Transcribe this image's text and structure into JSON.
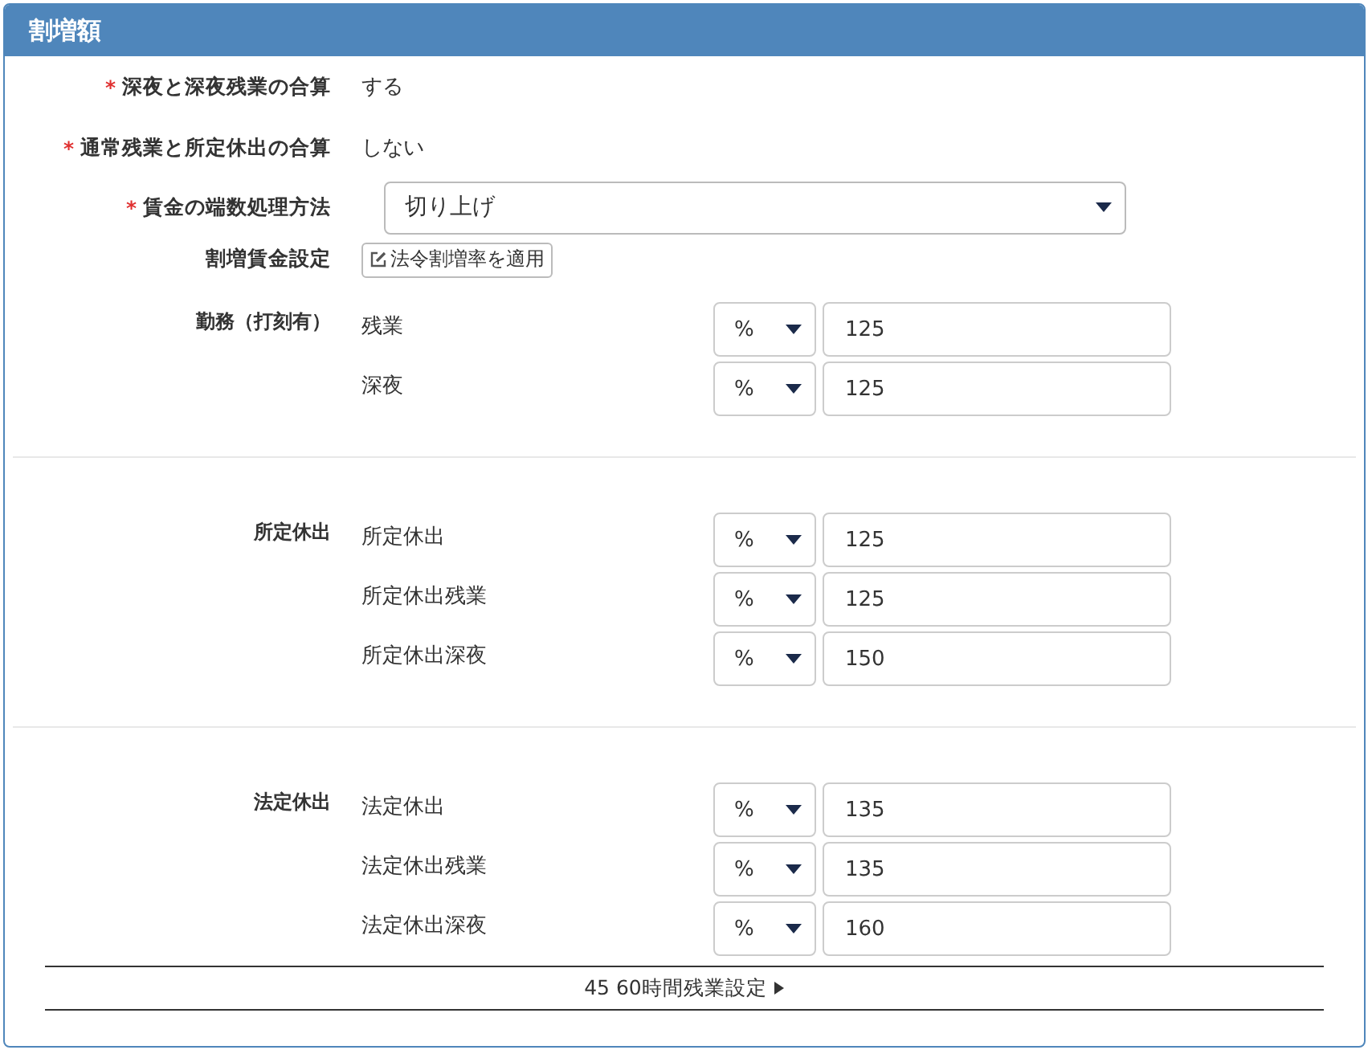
{
  "panel": {
    "title": "割増額"
  },
  "settings": [
    {
      "kind": "text",
      "required_mark": "*",
      "label": "深夜と深夜残業の合算",
      "value": "する"
    },
    {
      "kind": "text",
      "required_mark": "*",
      "label": "通常残業と所定休出の合算",
      "value": "しない"
    },
    {
      "kind": "select",
      "required_mark": "*",
      "label": "賃金の端数処理方法",
      "value": "切り上げ"
    },
    {
      "kind": "button",
      "label": "割増賃金設定",
      "value": "法令割増率を適用"
    }
  ],
  "groups": [
    {
      "label": "勤務（打刻有）",
      "rows": [
        {
          "label": "残業",
          "unit": "%",
          "value": "125"
        },
        {
          "label": "深夜",
          "unit": "%",
          "value": "125"
        }
      ]
    },
    {
      "label": "所定休出",
      "rows": [
        {
          "label": "所定休出",
          "unit": "%",
          "value": "125"
        },
        {
          "label": "所定休出残業",
          "unit": "%",
          "value": "125"
        },
        {
          "label": "所定休出深夜",
          "unit": "%",
          "value": "150"
        }
      ]
    },
    {
      "label": "法定休出",
      "rows": [
        {
          "label": "法定休出",
          "unit": "%",
          "value": "135"
        },
        {
          "label": "法定休出残業",
          "unit": "%",
          "value": "135"
        },
        {
          "label": "法定休出深夜",
          "unit": "%",
          "value": "160"
        }
      ]
    }
  ],
  "footer_toggle": {
    "label": "45 60時間残業設定",
    "expanded": false
  }
}
